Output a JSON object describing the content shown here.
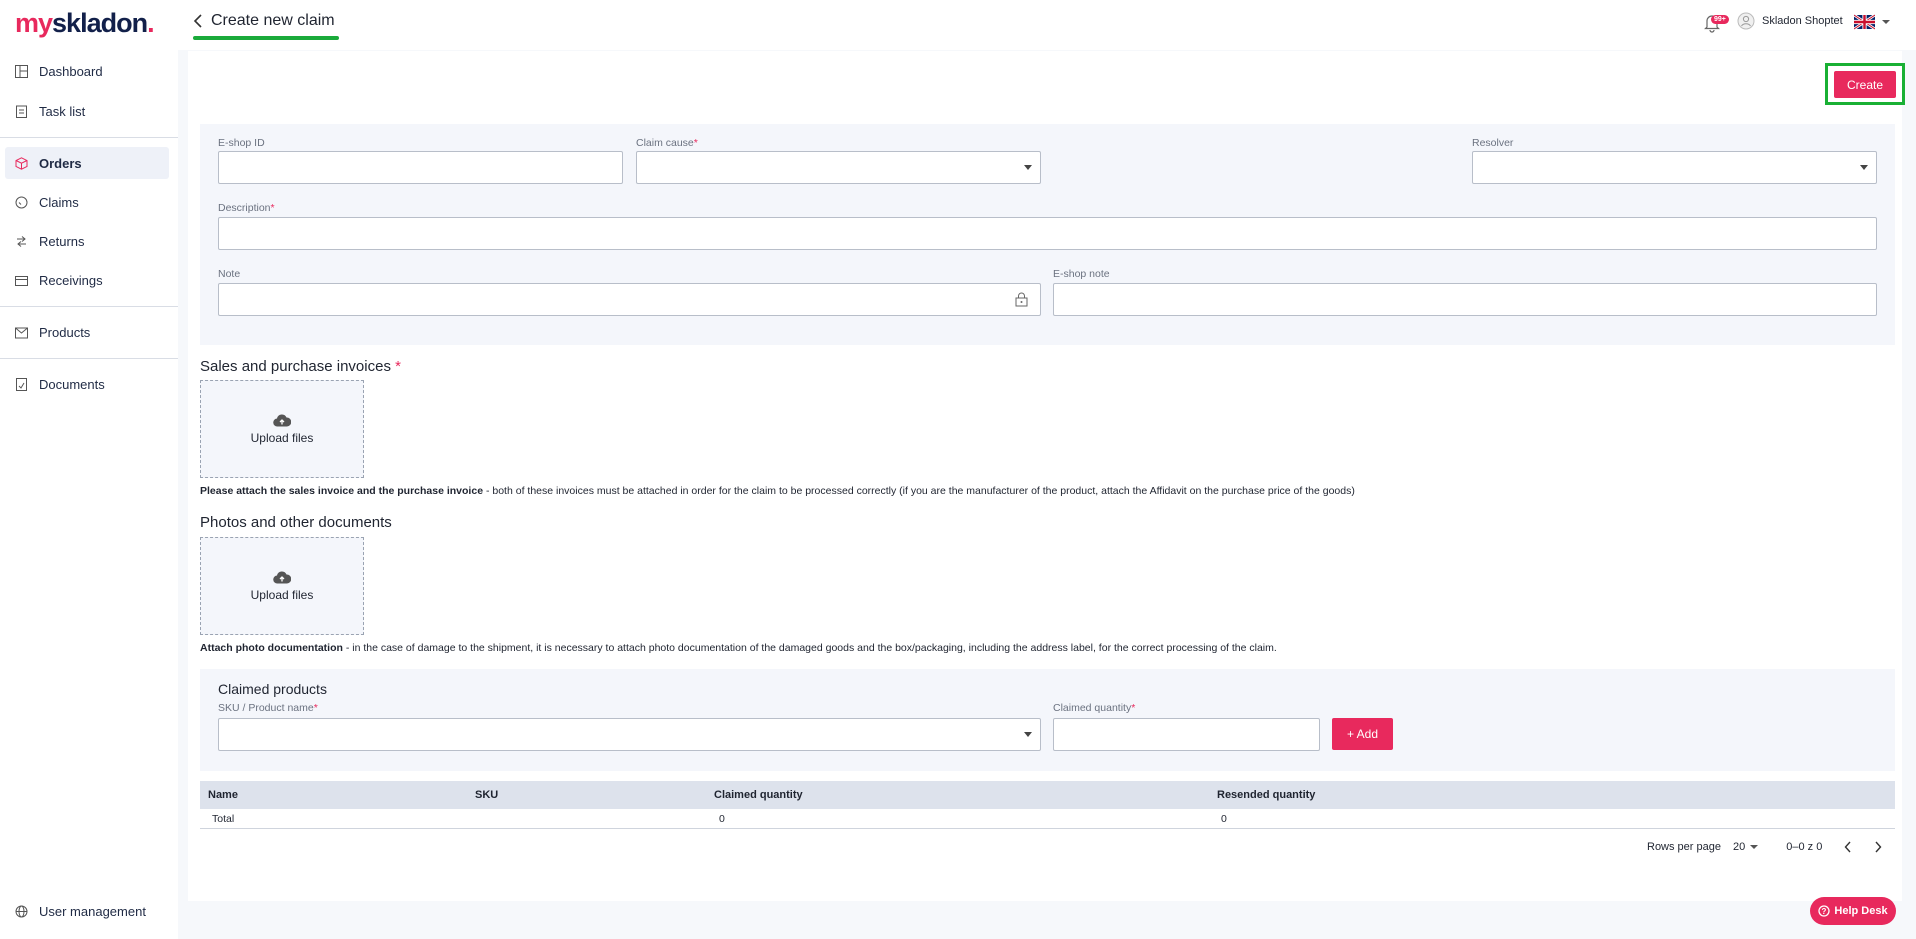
{
  "brand": {
    "my": "my",
    "skladon": "skladon",
    "dot": "."
  },
  "sidebar": {
    "items": [
      {
        "label": "Dashboard",
        "icon": "dashboard-icon"
      },
      {
        "label": "Task list",
        "icon": "tasklist-icon"
      },
      {
        "label": "Orders",
        "icon": "orders-icon",
        "active": true
      },
      {
        "label": "Claims",
        "icon": "claims-icon"
      },
      {
        "label": "Returns",
        "icon": "returns-icon"
      },
      {
        "label": "Receivings",
        "icon": "receivings-icon"
      },
      {
        "label": "Products",
        "icon": "products-icon"
      },
      {
        "label": "Documents",
        "icon": "documents-icon"
      }
    ],
    "user_management": "User management"
  },
  "header": {
    "title": "Create new claim",
    "notif_badge": "99+",
    "user_name": "Skladon Shoptet"
  },
  "actions": {
    "create": "Create"
  },
  "form": {
    "eshop_id": {
      "label": "E-shop ID",
      "value": ""
    },
    "claim_cause": {
      "label": "Claim cause",
      "req": "*",
      "value": ""
    },
    "resolver": {
      "label": "Resolver",
      "value": ""
    },
    "description": {
      "label": "Description",
      "req": "*",
      "value": ""
    },
    "note": {
      "label": "Note",
      "value": ""
    },
    "eshop_note": {
      "label": "E-shop note",
      "value": ""
    }
  },
  "invoices": {
    "title": "Sales and purchase invoices",
    "req": "*",
    "upload": "Upload files",
    "hint_bold": "Please attach the sales invoice and the purchase invoice",
    "hint_rest": " - both of these invoices must be attached in order for the claim to be processed correctly (if you are the manufacturer of the product, attach the Affidavit on the purchase price of the goods)"
  },
  "photos": {
    "title": "Photos and other documents",
    "upload": "Upload files",
    "hint_bold": "Attach photo documentation",
    "hint_rest": " - in the case of damage to the shipment, it is necessary to attach photo documentation of the damaged goods and the box/packaging, including the address label, for the correct processing of the claim."
  },
  "claimed": {
    "title": "Claimed products",
    "sku_label": "SKU / Product name",
    "qty_label": "Claimed quantity",
    "req": "*",
    "add": "+ Add"
  },
  "table": {
    "headers": [
      "Name",
      "SKU",
      "Claimed quantity",
      "Resended quantity"
    ],
    "total": {
      "name": "Total",
      "claimed": "0",
      "resended": "0"
    }
  },
  "pagination": {
    "rows_label": "Rows per page",
    "rows_value": "20",
    "range": "0–0 z 0"
  },
  "helpdesk": "Help Desk",
  "colors": {
    "accent": "#e8295d",
    "highlight": "#19b034",
    "navy": "#12204a"
  }
}
